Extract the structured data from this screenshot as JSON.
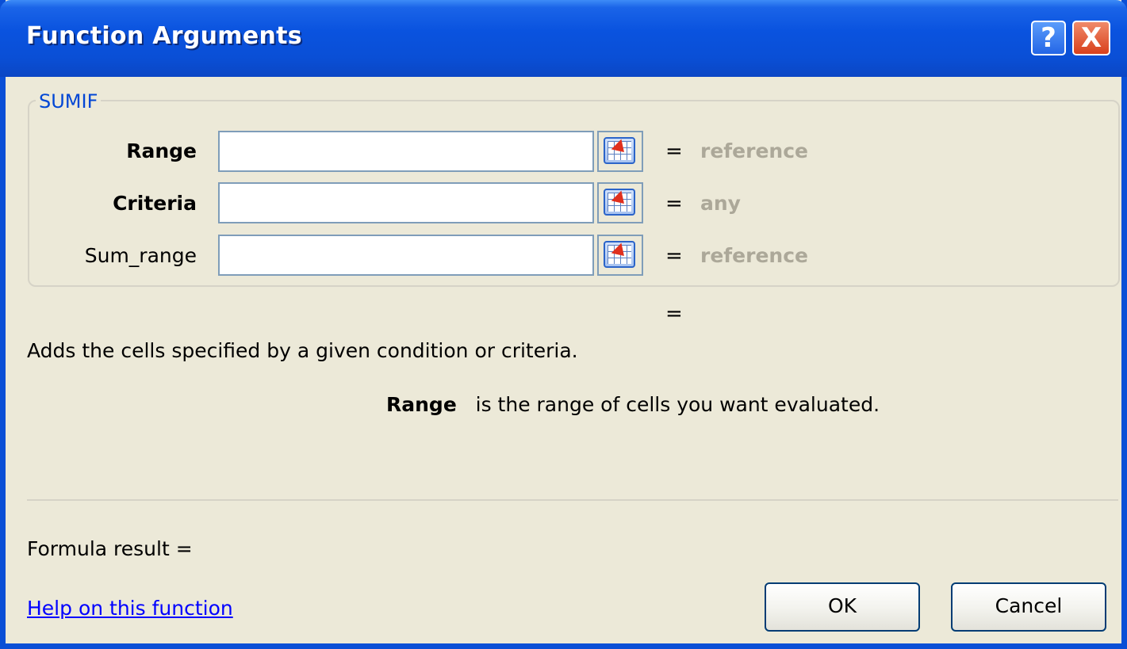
{
  "window": {
    "title": "Function Arguments",
    "help_symbol": "?",
    "close_symbol": "X"
  },
  "function": {
    "name": "SUMIF",
    "args": [
      {
        "label": "Range",
        "value": "",
        "bold": true,
        "result": "reference"
      },
      {
        "label": "Criteria",
        "value": "",
        "bold": true,
        "result": "any"
      },
      {
        "label": "Sum_range",
        "value": "",
        "bold": false,
        "result": "reference"
      }
    ],
    "result_equals": "=",
    "description": "Adds the cells specified by a given condition or criteria.",
    "arg_help_name": "Range",
    "arg_help_text": "is the range of cells you want evaluated."
  },
  "footer": {
    "formula_result_label": "Formula result =",
    "help_link": "Help on this function",
    "ok_label": "OK",
    "cancel_label": "Cancel"
  },
  "colors": {
    "titlebar": "#0a4fd6",
    "dialog_bg": "#ece9d8",
    "legend_text": "#0046d5",
    "greyed_value": "#aca899",
    "link": "#0000ff"
  },
  "icons": {
    "ref_button": "range-selector-icon",
    "help": "help-icon",
    "close": "close-icon"
  }
}
